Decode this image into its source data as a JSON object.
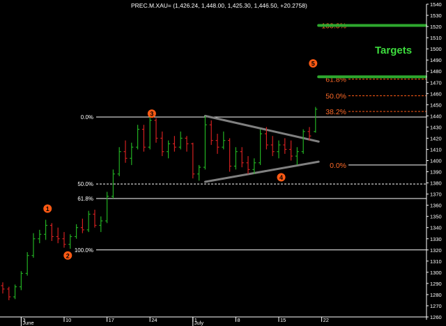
{
  "header": {
    "text": "PREC.M.XAU= (1,426.24, 1,448.00, 1,425.30, 1,446.50, +20.2758)"
  },
  "chart_data": {
    "type": "ohlc",
    "title": "PREC.M.XAU= (1,426.24, 1,448.00, 1,425.30, 1,446.50, +20.2758)",
    "ylim": [
      1260,
      1540
    ],
    "y_ticks": [
      1260,
      1270,
      1280,
      1290,
      1300,
      1310,
      1320,
      1330,
      1340,
      1350,
      1360,
      1370,
      1380,
      1390,
      1400,
      1410,
      1420,
      1430,
      1440,
      1450,
      1460,
      1470,
      1480,
      1490,
      1500,
      1510,
      1520,
      1530,
      1540
    ],
    "x_ticks": [
      {
        "day": 3,
        "label": "3"
      },
      {
        "day": 10,
        "label": "10"
      },
      {
        "day": 17,
        "label": "17"
      },
      {
        "day": 24,
        "label": "24"
      },
      {
        "day": 31,
        "label": "1"
      },
      {
        "day": 38,
        "label": "8"
      },
      {
        "day": 45,
        "label": "15"
      },
      {
        "day": 52,
        "label": "22"
      }
    ],
    "month_labels": [
      {
        "day": 3,
        "label": "June"
      },
      {
        "day": 31,
        "label": "July"
      }
    ],
    "axis_range_days": [
      0,
      57
    ],
    "ohlc": [
      {
        "day": 0,
        "o": 1288,
        "h": 1291,
        "l": 1281,
        "c": 1285
      },
      {
        "day": 1,
        "o": 1285,
        "h": 1287,
        "l": 1275,
        "c": 1278
      },
      {
        "day": 2,
        "o": 1278,
        "h": 1289,
        "l": 1276,
        "c": 1287
      },
      {
        "day": 3,
        "o": 1287,
        "h": 1301,
        "l": 1284,
        "c": 1299
      },
      {
        "day": 4,
        "o": 1299,
        "h": 1318,
        "l": 1297,
        "c": 1315
      },
      {
        "day": 5,
        "o": 1315,
        "h": 1335,
        "l": 1313,
        "c": 1330
      },
      {
        "day": 6,
        "o": 1330,
        "h": 1338,
        "l": 1326,
        "c": 1334
      },
      {
        "day": 7,
        "o": 1334,
        "h": 1347,
        "l": 1329,
        "c": 1342
      },
      {
        "day": 8,
        "o": 1342,
        "h": 1344,
        "l": 1328,
        "c": 1332
      },
      {
        "day": 9,
        "o": 1332,
        "h": 1340,
        "l": 1326,
        "c": 1330
      },
      {
        "day": 10,
        "o": 1330,
        "h": 1336,
        "l": 1322,
        "c": 1325
      },
      {
        "day": 11,
        "o": 1325,
        "h": 1334,
        "l": 1321,
        "c": 1332
      },
      {
        "day": 12,
        "o": 1332,
        "h": 1343,
        "l": 1330,
        "c": 1340
      },
      {
        "day": 13,
        "o": 1340,
        "h": 1348,
        "l": 1335,
        "c": 1338
      },
      {
        "day": 14,
        "o": 1338,
        "h": 1355,
        "l": 1336,
        "c": 1352
      },
      {
        "day": 15,
        "o": 1352,
        "h": 1356,
        "l": 1340,
        "c": 1342
      },
      {
        "day": 16,
        "o": 1342,
        "h": 1350,
        "l": 1336,
        "c": 1346
      },
      {
        "day": 17,
        "o": 1346,
        "h": 1372,
        "l": 1344,
        "c": 1368
      },
      {
        "day": 18,
        "o": 1368,
        "h": 1392,
        "l": 1366,
        "c": 1388
      },
      {
        "day": 19,
        "o": 1388,
        "h": 1412,
        "l": 1386,
        "c": 1408
      },
      {
        "day": 20,
        "o": 1408,
        "h": 1418,
        "l": 1398,
        "c": 1402
      },
      {
        "day": 21,
        "o": 1402,
        "h": 1416,
        "l": 1396,
        "c": 1412
      },
      {
        "day": 22,
        "o": 1412,
        "h": 1432,
        "l": 1410,
        "c": 1428
      },
      {
        "day": 23,
        "o": 1428,
        "h": 1432,
        "l": 1408,
        "c": 1412
      },
      {
        "day": 24,
        "o": 1412,
        "h": 1440,
        "l": 1410,
        "c": 1436
      },
      {
        "day": 25,
        "o": 1436,
        "h": 1438,
        "l": 1416,
        "c": 1420
      },
      {
        "day": 26,
        "o": 1420,
        "h": 1426,
        "l": 1404,
        "c": 1408
      },
      {
        "day": 27,
        "o": 1408,
        "h": 1418,
        "l": 1402,
        "c": 1415
      },
      {
        "day": 28,
        "o": 1415,
        "h": 1422,
        "l": 1408,
        "c": 1412
      },
      {
        "day": 29,
        "o": 1412,
        "h": 1426,
        "l": 1410,
        "c": 1420
      },
      {
        "day": 30,
        "o": 1420,
        "h": 1422,
        "l": 1408,
        "c": 1415
      },
      {
        "day": 31,
        "o": 1415,
        "h": 1416,
        "l": 1384,
        "c": 1388
      },
      {
        "day": 32,
        "o": 1388,
        "h": 1396,
        "l": 1382,
        "c": 1394
      },
      {
        "day": 33,
        "o": 1394,
        "h": 1440,
        "l": 1392,
        "c": 1432
      },
      {
        "day": 34,
        "o": 1432,
        "h": 1436,
        "l": 1414,
        "c": 1418
      },
      {
        "day": 35,
        "o": 1418,
        "h": 1424,
        "l": 1406,
        "c": 1412
      },
      {
        "day": 36,
        "o": 1412,
        "h": 1426,
        "l": 1410,
        "c": 1418
      },
      {
        "day": 37,
        "o": 1418,
        "h": 1420,
        "l": 1390,
        "c": 1395
      },
      {
        "day": 38,
        "o": 1395,
        "h": 1412,
        "l": 1392,
        "c": 1408
      },
      {
        "day": 39,
        "o": 1408,
        "h": 1412,
        "l": 1394,
        "c": 1398
      },
      {
        "day": 40,
        "o": 1398,
        "h": 1404,
        "l": 1388,
        "c": 1392
      },
      {
        "day": 41,
        "o": 1392,
        "h": 1402,
        "l": 1388,
        "c": 1398
      },
      {
        "day": 42,
        "o": 1398,
        "h": 1428,
        "l": 1396,
        "c": 1424
      },
      {
        "day": 43,
        "o": 1424,
        "h": 1430,
        "l": 1410,
        "c": 1414
      },
      {
        "day": 44,
        "o": 1414,
        "h": 1422,
        "l": 1404,
        "c": 1408
      },
      {
        "day": 45,
        "o": 1408,
        "h": 1418,
        "l": 1402,
        "c": 1414
      },
      {
        "day": 46,
        "o": 1414,
        "h": 1420,
        "l": 1406,
        "c": 1410
      },
      {
        "day": 47,
        "o": 1410,
        "h": 1418,
        "l": 1400,
        "c": 1404
      },
      {
        "day": 48,
        "o": 1404,
        "h": 1412,
        "l": 1396,
        "c": 1408
      },
      {
        "day": 49,
        "o": 1408,
        "h": 1428,
        "l": 1406,
        "c": 1426
      },
      {
        "day": 50,
        "o": 1426,
        "h": 1430,
        "l": 1418,
        "c": 1422
      },
      {
        "day": 51,
        "o": 1426,
        "h": 1448,
        "l": 1425,
        "c": 1446
      }
    ],
    "levels": [
      {
        "price": 1439,
        "label": "0.0%",
        "style": "solid",
        "side": "left"
      },
      {
        "price": 1379,
        "label": "50.0%",
        "style": "dashed",
        "side": "left"
      },
      {
        "price": 1366,
        "label": "61.8%",
        "style": "solid",
        "side": "left"
      },
      {
        "price": 1320,
        "label": "100.0%",
        "style": "solid",
        "side": "left"
      },
      {
        "price": 1396,
        "label": "0.0%",
        "style": "solid",
        "side": "right"
      },
      {
        "price": 1444,
        "label": "38.2%",
        "style": "dashed",
        "side": "right"
      },
      {
        "price": 1458,
        "label": "50.0%",
        "style": "dashed",
        "side": "right"
      },
      {
        "price": 1473,
        "label": "61.8%",
        "style": "dashed",
        "side": "right"
      },
      {
        "price": 1521,
        "label": "100.0%",
        "style": "solid",
        "side": "right"
      }
    ],
    "trendlines": [
      {
        "from": {
          "day": 33,
          "price": 1440
        },
        "to": {
          "day": 51.5,
          "price": 1417
        }
      },
      {
        "from": {
          "day": 33,
          "price": 1381
        },
        "to": {
          "day": 51.5,
          "price": 1399
        }
      }
    ],
    "targets": [
      {
        "price": 1521,
        "from_day": 51.5
      },
      {
        "price": 1475,
        "from_day": 51.5
      }
    ],
    "targets_label": "Targets",
    "wave_markers": [
      {
        "label": "1",
        "day": 7.3,
        "price": 1357
      },
      {
        "label": "2",
        "day": 10.6,
        "price": 1315
      },
      {
        "label": "3",
        "day": 24.3,
        "price": 1442
      },
      {
        "label": "4",
        "day": 45.4,
        "price": 1385
      },
      {
        "label": "5",
        "day": 50.6,
        "price": 1487
      }
    ],
    "colors": {
      "background": "#000000",
      "up_bar": "#22b022",
      "down_bar": "#d22020",
      "level_line": "#ffffff",
      "level_line_right": "#ff5a14",
      "level_label_left": "#ffffff",
      "level_label_right": "#ff6a28",
      "target": "#2ea82e",
      "targets_text": "#3ddc3d",
      "trendline": "#808080",
      "marker": "#ff5a14",
      "axis_text": "#ffffff"
    }
  }
}
